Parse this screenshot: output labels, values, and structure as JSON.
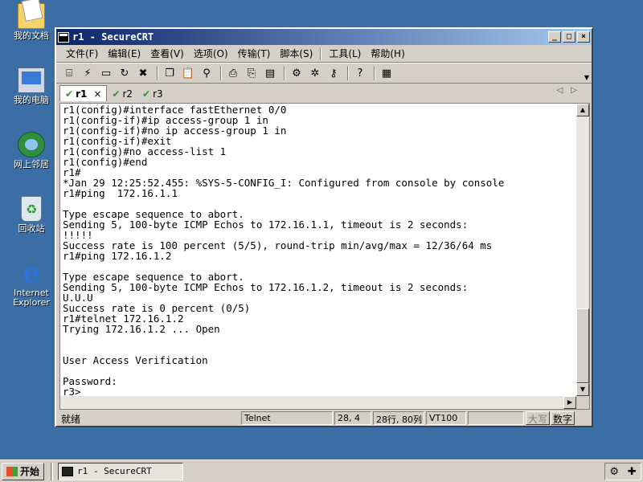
{
  "desktop": {
    "icons": [
      {
        "label": "我的文档"
      },
      {
        "label": "我的电脑"
      },
      {
        "label": "网上邻居"
      },
      {
        "label": "回收站"
      },
      {
        "label": "Internet Explorer"
      }
    ]
  },
  "window": {
    "title": "r1 - SecureCRT",
    "controls": {
      "minimize": "_",
      "maximize": "□",
      "close": "×"
    }
  },
  "menu": [
    "文件(F)",
    "编辑(E)",
    "查看(V)",
    "选项(O)",
    "传输(T)",
    "脚本(S)",
    "工具(L)",
    "帮助(H)"
  ],
  "toolbar": {
    "icons": [
      "connect-icon",
      "quick-connect-icon",
      "connect-tab-icon",
      "reconnect-icon",
      "disconnect-icon",
      "copy-icon",
      "paste-icon",
      "find-icon",
      "print-icon",
      "print-selection-icon",
      "print-setup-icon",
      "session-options-icon",
      "global-options-icon",
      "keymap-icon",
      "help-icon",
      "sftp-icon"
    ]
  },
  "tabs": [
    {
      "label": "r1",
      "active": true,
      "close": "×"
    },
    {
      "label": "r2",
      "active": false
    },
    {
      "label": "r3",
      "active": false
    }
  ],
  "terminal": {
    "lines": [
      "r1(config)#interface fastEthernet 0/0",
      "r1(config-if)#ip access-group 1 in",
      "r1(config-if)#no ip access-group 1 in",
      "r1(config-if)#exit",
      "r1(config)#no access-list 1",
      "r1(config)#end",
      "r1#",
      "*Jan 29 12:25:52.455: %SYS-5-CONFIG_I: Configured from console by console",
      "r1#ping  172.16.1.1",
      "",
      "Type escape sequence to abort.",
      "Sending 5, 100-byte ICMP Echos to 172.16.1.1, timeout is 2 seconds:",
      "!!!!!",
      "Success rate is 100 percent (5/5), round-trip min/avg/max = 12/36/64 ms",
      "r1#ping 172.16.1.2",
      "",
      "Type escape sequence to abort.",
      "Sending 5, 100-byte ICMP Echos to 172.16.1.2, timeout is 2 seconds:",
      "U.U.U",
      "Success rate is 0 percent (0/5)",
      "r1#telnet 172.16.1.2",
      "Trying 172.16.1.2 ... Open",
      "",
      "",
      "User Access Verification",
      "",
      "Password:",
      "r3>"
    ]
  },
  "status": {
    "ready": "就绪",
    "protocol": "Telnet",
    "cursor": "28,  4",
    "size": "28行, 80列",
    "emulation": "VT100",
    "blank": "",
    "caps": "大写",
    "num": "数字"
  },
  "taskbar": {
    "start": "开始",
    "task": "r1 - SecureCRT"
  }
}
